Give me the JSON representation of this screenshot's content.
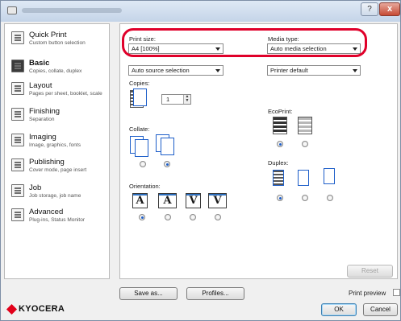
{
  "window": {
    "help_glyph": "?",
    "close_glyph": "x"
  },
  "sidebar": {
    "items": [
      {
        "label": "Quick Print",
        "sub": "Custom button selection",
        "icon": "quick-print-icon"
      },
      {
        "label": "Basic",
        "sub": "Copies, collate, duplex",
        "icon": "printer-icon"
      },
      {
        "label": "Layout",
        "sub": "Pages per sheet, booklet, scale",
        "icon": "layout-icon"
      },
      {
        "label": "Finishing",
        "sub": "Separation",
        "icon": "finishing-icon"
      },
      {
        "label": "Imaging",
        "sub": "Image, graphics, fonts",
        "icon": "imaging-icon"
      },
      {
        "label": "Publishing",
        "sub": "Cover mode, page insert",
        "icon": "publishing-icon"
      },
      {
        "label": "Job",
        "sub": "Job storage, job name",
        "icon": "job-icon"
      },
      {
        "label": "Advanced",
        "sub": "Plug-ins, Status Monitor",
        "icon": "advanced-icon"
      }
    ],
    "active_index": 1
  },
  "basic": {
    "print_size_label": "Print size:",
    "print_size_value": "A4 [100%]",
    "media_type_label": "Media type:",
    "media_type_value": "Auto media selection",
    "source_value": "Auto source selection",
    "destination_value": "Printer default",
    "copies_label": "Copies:",
    "copies_value": "1",
    "collate_label": "Collate:",
    "orientation_label": "Orientation:",
    "ecoprint_label": "EcoPrint:",
    "duplex_label": "Duplex:",
    "orientation_glyphs": [
      "A",
      "A",
      "V",
      "V"
    ],
    "collate_selected": 1,
    "orientation_selected": 0,
    "ecoprint_selected": 0,
    "duplex_selected": 0
  },
  "buttons": {
    "reset": "Reset",
    "save_as": "Save as...",
    "profiles": "Profiles...",
    "print_preview": "Print preview",
    "ok": "OK",
    "cancel": "Cancel"
  },
  "brand": {
    "logo_text": "KYOCERA",
    "accent": "#e2001a",
    "highlight": "#e0002a"
  }
}
